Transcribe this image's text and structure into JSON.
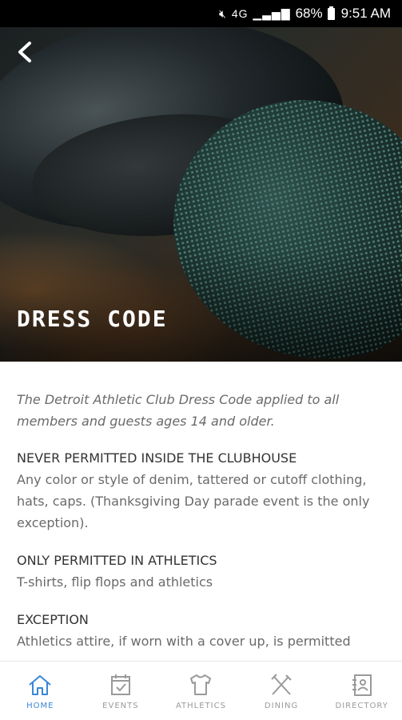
{
  "status_bar": {
    "signal_text": "4G",
    "battery": "68%",
    "time": "9:51 AM"
  },
  "header": {
    "title": "DRESS CODE",
    "back_icon": "chevron-left-icon"
  },
  "content": {
    "intro": "The Detroit Athletic Club Dress Code applied to all members and guests ages 14 and older.",
    "sections": [
      {
        "heading": "NEVER PERMITTED INSIDE THE CLUBHOUSE",
        "body": "Any color or style of denim, tattered or cutoff clothing, hats, caps. (Thanksgiving Day parade event is the only exception)."
      },
      {
        "heading": "ONLY PERMITTED IN ATHLETICS",
        "body": "T-shirts, flip flops and athletics"
      },
      {
        "heading": "EXCEPTION",
        "body": "Athletics attire, if worn with a cover up, is permitted"
      }
    ]
  },
  "tabs": [
    {
      "label": "HOME",
      "icon": "home-icon",
      "active": true
    },
    {
      "label": "EVENTS",
      "icon": "calendar-icon",
      "active": false
    },
    {
      "label": "ATHLETICS",
      "icon": "shirt-icon",
      "active": false
    },
    {
      "label": "DINING",
      "icon": "utensils-icon",
      "active": false
    },
    {
      "label": "DIRECTORY",
      "icon": "directory-icon",
      "active": false
    }
  ],
  "colors": {
    "accent": "#3a86d6",
    "inactive_tab": "#9a9a9a",
    "body_text": "#6a6a6a"
  }
}
